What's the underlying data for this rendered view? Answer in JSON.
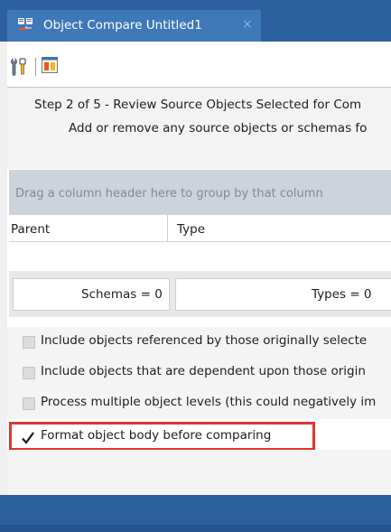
{
  "window": {
    "tab_title": "Object Compare Untitled1",
    "tab_close_glyph": "×",
    "tab_icon": "object-compare-icon"
  },
  "toolbar": {
    "items": [
      {
        "icon": "options-wrench-icon"
      },
      {
        "icon": "compare-window-icon"
      }
    ]
  },
  "step": {
    "title": "Step 2 of 5 - Review Source Objects Selected for Com",
    "description": "Add or remove any source objects or schemas fo"
  },
  "grid": {
    "group_hint": "Drag a column header here to group by that column",
    "columns": [
      "Parent",
      "Type"
    ],
    "rows": []
  },
  "summary": {
    "schemas": "Schemas = 0",
    "types": "Types = 0"
  },
  "options": [
    {
      "label": "Include objects referenced by those originally selecte",
      "checked": false
    },
    {
      "label": "Include objects that are dependent upon those origin",
      "checked": false
    },
    {
      "label": "Process multiple object levels (this could negatively im",
      "checked": false
    },
    {
      "label": "Format object body before comparing",
      "checked": true,
      "highlighted": true
    }
  ],
  "colors": {
    "titlebar": "#2c5f9e",
    "active_tab": "#3f78b8",
    "highlight": "#e03434",
    "grouping_area": "#cdd3db"
  }
}
